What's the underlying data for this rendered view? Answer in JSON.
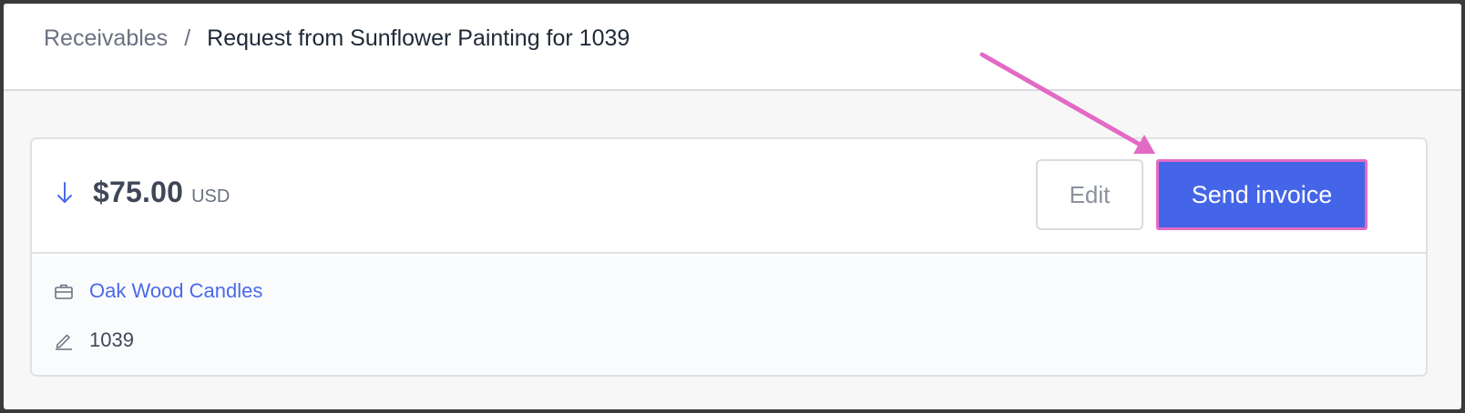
{
  "breadcrumb": {
    "parent": "Receivables",
    "separator": "/",
    "current": "Request from Sunflower Painting for 1039"
  },
  "card": {
    "direction_icon": "arrow-down-icon",
    "amount": "$75.00",
    "currency": "USD",
    "edit_label": "Edit",
    "send_label": "Send invoice",
    "customer_icon": "briefcase-icon",
    "customer_name": "Oak Wood Candles",
    "reference_icon": "pencil-icon",
    "reference": "1039"
  },
  "colors": {
    "accent": "#4565e8",
    "annotation": "#e36ac4",
    "link": "#4a6ae8"
  }
}
